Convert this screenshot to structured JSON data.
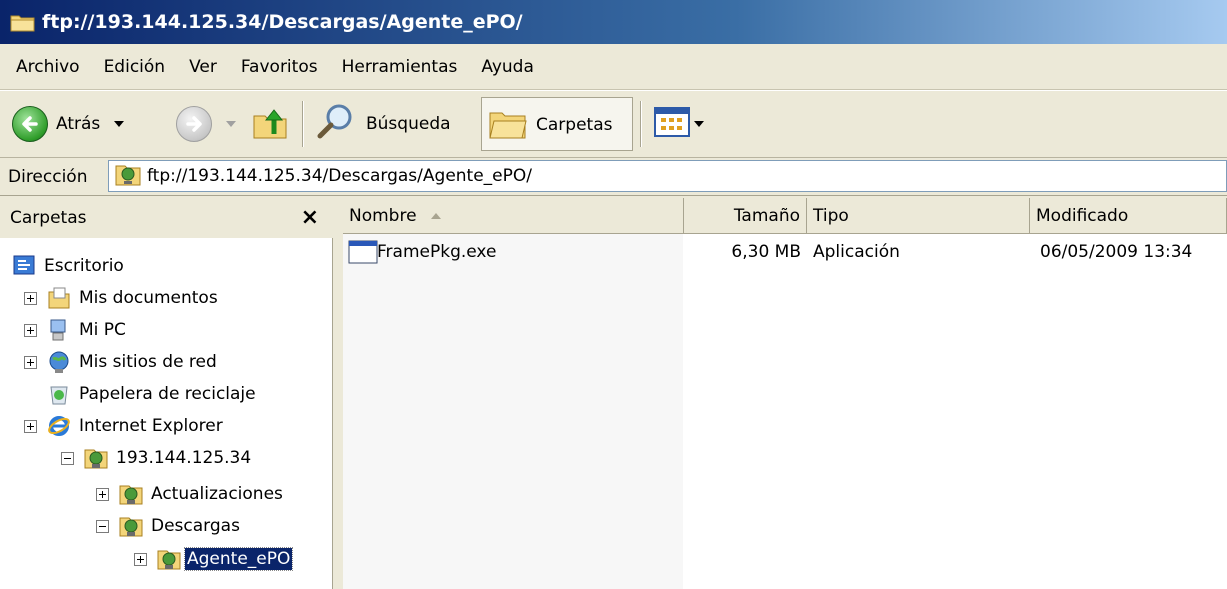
{
  "window": {
    "title": "ftp://193.144.125.34/Descargas/Agente_ePO/"
  },
  "menu": [
    "Archivo",
    "Edición",
    "Ver",
    "Favoritos",
    "Herramientas",
    "Ayuda"
  ],
  "toolbar": {
    "back_label": "Atrás",
    "search_label": "Búsqueda",
    "folders_label": "Carpetas"
  },
  "address": {
    "label": "Dirección",
    "value": "ftp://193.144.125.34/Descargas/Agente_ePO/"
  },
  "folders_pane": {
    "title": "Carpetas",
    "close": "×",
    "tree": [
      "Escritorio",
      "Mis documentos",
      "Mi PC",
      "Mis sitios de red",
      "Papelera de reciclaje",
      "Internet Explorer",
      "193.144.125.34",
      "Actualizaciones",
      "Descargas",
      "Agente_ePO"
    ]
  },
  "columns": [
    "Nombre",
    "Tamaño",
    "Tipo",
    "Modificado"
  ],
  "files": [
    {
      "name": "FramePkg.exe",
      "size": "6,30 MB",
      "type": "Aplicación",
      "modified": "06/05/2009 13:34"
    }
  ],
  "colors": {
    "title_start": "#0a246a",
    "title_end": "#a6caf0",
    "selection": "#0a246a",
    "chrome": "#ece9d8"
  }
}
